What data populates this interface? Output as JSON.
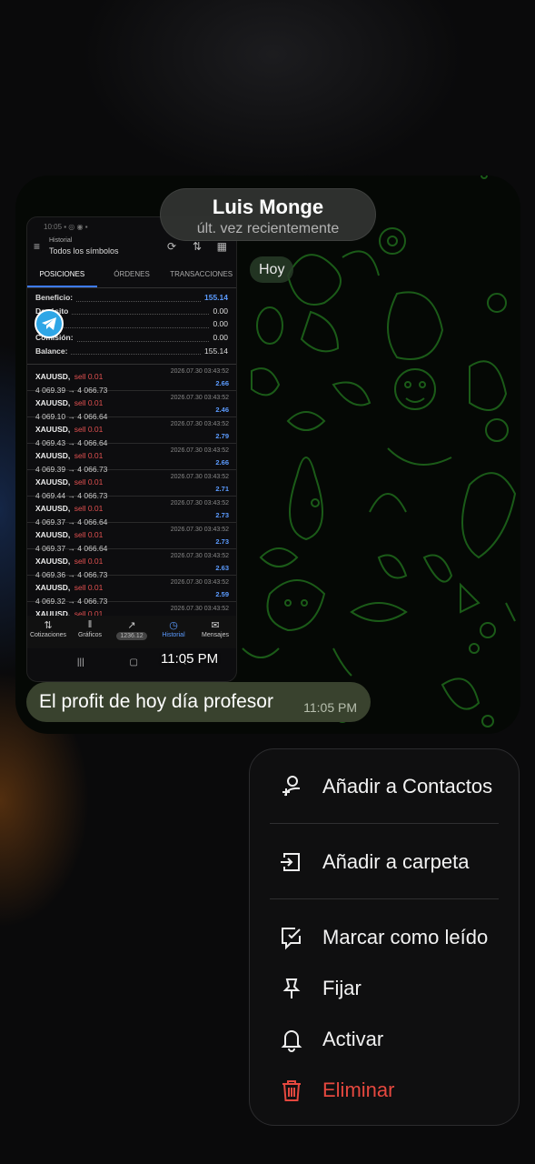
{
  "chat": {
    "name": "Luis Monge",
    "status": "últ. vez recientemente",
    "date_chip": "Hoy",
    "message_text": "El profit de hoy día profesor",
    "message_time": "11:05 PM",
    "photo_time": "11:05 PM"
  },
  "photo": {
    "status_bar": "10:05 ▪ ◎ ◉ ▪",
    "header": {
      "subtitle": "Historial",
      "title": "Todos los símbolos"
    },
    "tabs": [
      "POSICIONES",
      "ÓRDENES",
      "TRANSACCIONES"
    ],
    "summary": [
      {
        "label": "Beneficio:",
        "value": "155.14",
        "highlight": true
      },
      {
        "label": "Depósito",
        "value": "0.00"
      },
      {
        "label": "",
        "value": "0.00"
      },
      {
        "label": "Comisión:",
        "value": "0.00"
      },
      {
        "label": "Balance:",
        "value": "155.14"
      }
    ],
    "trades": [
      {
        "symbol": "XAUUSD,",
        "side": "sell 0.01",
        "prices": "4 069.39 → 4 066.73",
        "time": "2026.07.30 03:43:52",
        "profit": "2.66"
      },
      {
        "symbol": "XAUUSD,",
        "side": "sell 0.01",
        "prices": "4 069.10 → 4 066.64",
        "time": "2026.07.30 03:43:52",
        "profit": "2.46"
      },
      {
        "symbol": "XAUUSD,",
        "side": "sell 0.01",
        "prices": "4 069.43 → 4 066.64",
        "time": "2026.07.30 03:43:52",
        "profit": "2.79"
      },
      {
        "symbol": "XAUUSD,",
        "side": "sell 0.01",
        "prices": "4 069.39 → 4 066.73",
        "time": "2026.07.30 03:43:52",
        "profit": "2.66"
      },
      {
        "symbol": "XAUUSD,",
        "side": "sell 0.01",
        "prices": "4 069.44 → 4 066.73",
        "time": "2026.07.30 03:43:52",
        "profit": "2.71"
      },
      {
        "symbol": "XAUUSD,",
        "side": "sell 0.01",
        "prices": "4 069.37 → 4 066.64",
        "time": "2026.07.30 03:43:52",
        "profit": "2.73"
      },
      {
        "symbol": "XAUUSD,",
        "side": "sell 0.01",
        "prices": "4 069.37 → 4 066.64",
        "time": "2026.07.30 03:43:52",
        "profit": "2.73"
      },
      {
        "symbol": "XAUUSD,",
        "side": "sell 0.01",
        "prices": "4 069.36 → 4 066.73",
        "time": "2026.07.30 03:43:52",
        "profit": "2.63"
      },
      {
        "symbol": "XAUUSD,",
        "side": "sell 0.01",
        "prices": "4 069.32 → 4 066.73",
        "time": "2026.07.30 03:43:52",
        "profit": "2.59"
      },
      {
        "symbol": "XAUUSD,",
        "side": "sell 0.01",
        "prices": "",
        "time": "2026.07.30 03:43:52",
        "profit": ""
      }
    ],
    "nav": [
      {
        "label": "Cotizaciones",
        "glyph": "⇅"
      },
      {
        "label": "Gráficos",
        "glyph": "‖"
      },
      {
        "label": "",
        "glyph": "↗",
        "badge": "1236.12"
      },
      {
        "label": "Historial",
        "glyph": "◷",
        "active": true
      },
      {
        "label": "Mensajes",
        "glyph": "✉"
      }
    ],
    "sysnav": [
      "|||",
      "▢",
      "‹"
    ]
  },
  "menu": {
    "items": [
      {
        "label": "Añadir a Contactos",
        "icon": "add-contact-icon"
      },
      {
        "label": "Añadir a carpeta",
        "icon": "add-to-folder-icon"
      },
      {
        "label": "Marcar como leído",
        "icon": "mark-read-icon"
      },
      {
        "label": "Fijar",
        "icon": "pin-icon"
      },
      {
        "label": "Activar",
        "icon": "bell-icon"
      },
      {
        "label": "Eliminar",
        "icon": "trash-icon",
        "danger": true
      }
    ]
  },
  "colors": {
    "accent_blue": "#5b9bff",
    "danger": "#e5483f",
    "bubble": "#39422e",
    "doodle": "#1f5a1a"
  }
}
